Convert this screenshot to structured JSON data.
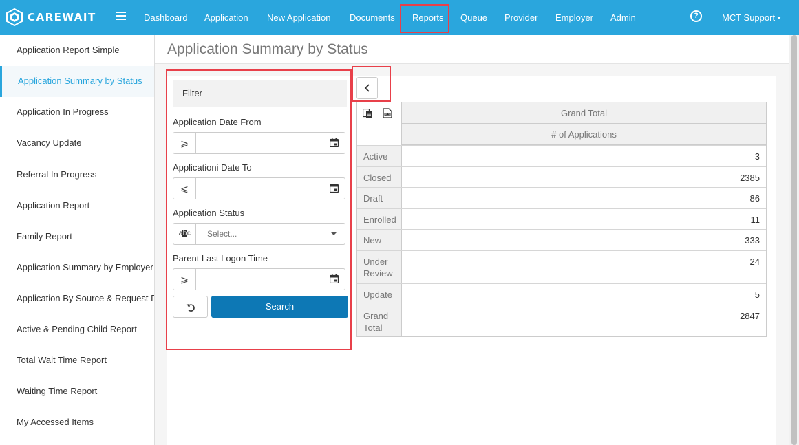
{
  "app": {
    "logo_text": "CAREWAIT",
    "brand_color": "#2aa6dd",
    "highlight_color": "#e8404a",
    "primary_button_color": "#0d78b5"
  },
  "nav": {
    "items": [
      "Dashboard",
      "Application",
      "New Application",
      "Documents",
      "Reports",
      "Queue",
      "Provider",
      "Employer",
      "Admin"
    ],
    "active": "Reports",
    "help_icon": "?",
    "user_label": "MCT Support"
  },
  "sidebar": {
    "items": [
      "Application Report Simple",
      "Application Summary by Status",
      "Application In Progress",
      "Vacancy Update",
      "Referral In Progress",
      "Application Report",
      "Family Report",
      "Application Summary by Employer",
      "Application By Source & Request Date",
      "Active & Pending Child Report",
      "Total Wait Time Report",
      "Waiting Time Report",
      "My Accessed Items"
    ],
    "active_index": 1
  },
  "page": {
    "title": "Application Summary by Status"
  },
  "filter": {
    "heading": "Filter",
    "fields": [
      {
        "label": "Application Date From",
        "operator": "⩾",
        "value": "",
        "kind": "date"
      },
      {
        "label": "Applicationi Date To",
        "operator": "⩽",
        "value": "",
        "kind": "date"
      },
      {
        "label": "Application Status",
        "operator": "abc",
        "placeholder": "Select...",
        "kind": "select"
      },
      {
        "label": "Parent Last Logon Time",
        "operator": "⩾",
        "value": "",
        "kind": "date"
      }
    ],
    "search_label": "Search",
    "reset_icon": "undo-icon"
  },
  "pivot": {
    "column_header": "Grand Total",
    "measure_header": "# of Applications",
    "rows": [
      {
        "label": "Active",
        "value": "3"
      },
      {
        "label": "Closed",
        "value": "2385"
      },
      {
        "label": "Draft",
        "value": "86"
      },
      {
        "label": "Enrolled",
        "value": "11"
      },
      {
        "label": "New",
        "value": "333"
      },
      {
        "label": "Under Review",
        "value": "24"
      },
      {
        "label": "Update",
        "value": "5"
      },
      {
        "label": "Grand Total",
        "value": "2847"
      }
    ]
  }
}
